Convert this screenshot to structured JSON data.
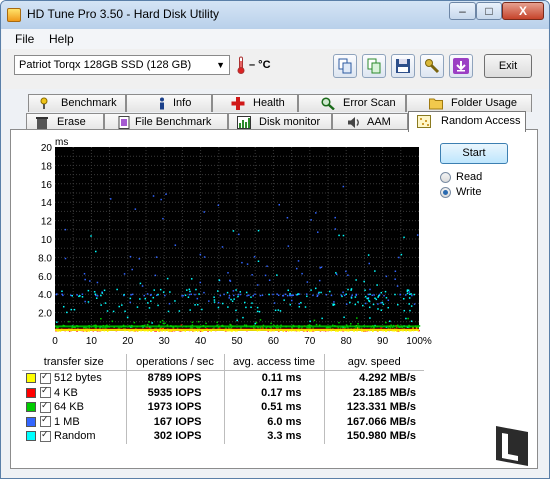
{
  "window": {
    "title": "HD Tune Pro 3.50 - Hard Disk Utility",
    "minimize": "–",
    "maximize": "□",
    "close": "X"
  },
  "menu": {
    "file": "File",
    "help": "Help"
  },
  "toolbar": {
    "drive": "Patriot Torqx 128GB SSD (128 GB)",
    "temperature": "– °C",
    "exit": "Exit"
  },
  "tabs_top": [
    {
      "label": "Benchmark",
      "icon": "benchmark-icon"
    },
    {
      "label": "Info",
      "icon": "info-icon"
    },
    {
      "label": "Health",
      "icon": "health-cross-icon"
    },
    {
      "label": "Error Scan",
      "icon": "magnifier-icon"
    },
    {
      "label": "Folder Usage",
      "icon": "folder-icon"
    }
  ],
  "tabs_bottom": [
    {
      "label": "Erase",
      "icon": "trash-icon"
    },
    {
      "label": "File Benchmark",
      "icon": "file-benchmark-icon"
    },
    {
      "label": "Disk monitor",
      "icon": "disk-monitor-icon"
    },
    {
      "label": "AAM",
      "icon": "speaker-icon"
    },
    {
      "label": "Random Access",
      "icon": "random-access-icon",
      "active": true
    }
  ],
  "controls": {
    "start": "Start",
    "read": "Read",
    "write": "Write",
    "selected": "Write"
  },
  "chart_data": {
    "type": "scatter",
    "ylabel": "ms",
    "ylim": [
      0,
      20
    ],
    "xlim": [
      0,
      100
    ],
    "yticks": [
      "20",
      "18",
      "16",
      "14",
      "12",
      "10",
      "8.0",
      "6.0",
      "4.0",
      "2.0"
    ],
    "xticks": [
      "0",
      "10",
      "20",
      "30",
      "40",
      "50",
      "60",
      "70",
      "80",
      "90",
      "100%"
    ],
    "grid": true,
    "background": "#000000",
    "series": [
      {
        "name": "512 bytes",
        "color": "#ffff00",
        "typical_ms": 0.11
      },
      {
        "name": "4 KB",
        "color": "#ff0000",
        "typical_ms": 0.17
      },
      {
        "name": "64 KB",
        "color": "#00cc00",
        "typical_ms": 0.51
      },
      {
        "name": "1 MB",
        "color": "#3366ff",
        "typical_ms": 6.0
      },
      {
        "name": "Random",
        "color": "#00ffff",
        "typical_ms": 3.3
      }
    ]
  },
  "results": {
    "headers": {
      "size": "transfer size",
      "ops": "operations / sec",
      "access": "avg. access time",
      "speed": "agv. speed"
    },
    "rows": [
      {
        "name": "512 bytes",
        "color": "#ffff00",
        "ops": "8789 IOPS",
        "access": "0.11 ms",
        "speed": "4.292 MB/s"
      },
      {
        "name": "4 KB",
        "color": "#ff0000",
        "ops": "5935 IOPS",
        "access": "0.17 ms",
        "speed": "23.185 MB/s"
      },
      {
        "name": "64 KB",
        "color": "#00cc00",
        "ops": "1973 IOPS",
        "access": "0.51 ms",
        "speed": "123.331 MB/s"
      },
      {
        "name": "1 MB",
        "color": "#3366ff",
        "ops": "167 IOPS",
        "access": "6.0 ms",
        "speed": "167.066 MB/s"
      },
      {
        "name": "Random",
        "color": "#00ffff",
        "ops": "302 IOPS",
        "access": "3.3 ms",
        "speed": "150.980 MB/s"
      }
    ]
  }
}
